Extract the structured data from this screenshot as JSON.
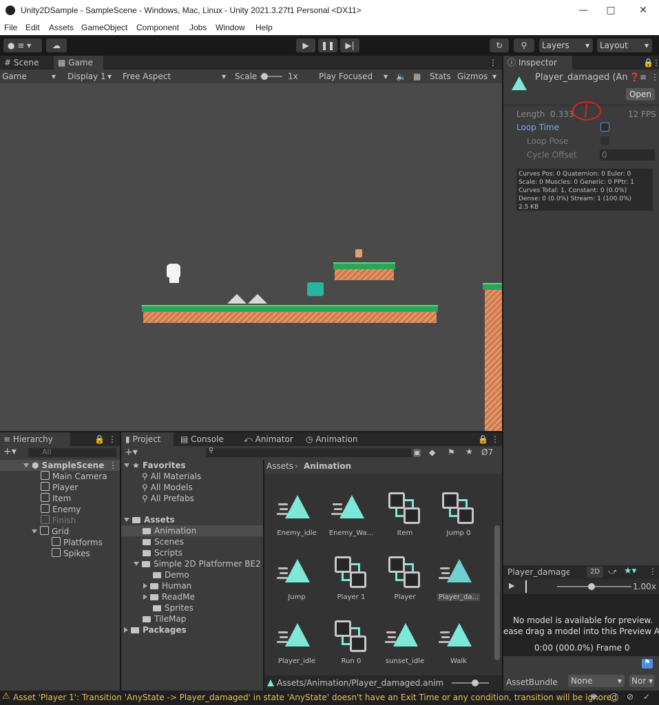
{
  "window": {
    "title": "Unity2DSample - SampleScene - Windows, Mac, Linux - Unity 2021.3.27f1 Personal <DX11>"
  },
  "menu": [
    "File",
    "Edit",
    "Assets",
    "GameObject",
    "Component",
    "Jobs",
    "Window",
    "Help"
  ],
  "toolbar": {
    "layers": "Layers",
    "layout": "Layout"
  },
  "tabs": {
    "scene": "Scene",
    "game": "Game"
  },
  "game_bar": {
    "mode": "Game",
    "display": "Display 1",
    "aspect": "Free Aspect",
    "scale_label": "Scale",
    "scale_value": "1x",
    "play_mode": "Play Focused",
    "stats": "Stats",
    "gizmos": "Gizmos"
  },
  "inspector": {
    "tab": "Inspector",
    "asset_name": "Player_damaged (An",
    "open_button": "Open",
    "length_label": "Length",
    "length_value": "0.333",
    "fps": "12 FPS",
    "loop_time": "Loop Time",
    "loop_pose": "Loop Pose",
    "cycle_offset": "Cycle Offset",
    "cycle_offset_value": "0",
    "info": [
      "Curves Pos: 0 Quaternion: 0 Euler: 0",
      "Scale: 0 Muscles: 0 Generic: 0 PPtr: 1",
      "Curves Total: 1, Constant: 0 (0.0%)",
      "Dense: 0 (0.0%) Stream: 1 (100.0%)",
      "2.5 KB"
    ]
  },
  "preview": {
    "title": "Player_damage",
    "mode_2d": "2D",
    "speed": "1.00x",
    "no_model": "No model is available for preview.",
    "drag_hint": "ease drag a model into this Preview Are",
    "time": "0:00 (000.0%) Frame 0",
    "assetbundle_label": "AssetBundle",
    "assetbundle_value": "None",
    "variant_value": "Nor"
  },
  "hierarchy": {
    "tab": "Hierarchy",
    "search_placeholder": "All",
    "scene": "SampleScene",
    "items": [
      "Main Camera",
      "Player",
      "Item",
      "Enemy",
      "Finish",
      "Grid",
      "Platforms",
      "Spikes"
    ]
  },
  "bottom_tabs": {
    "project": "Project",
    "console": "Console",
    "animator": "Animator",
    "animation": "Animation"
  },
  "project": {
    "favorites": "Favorites",
    "favorites_items": [
      "All Materials",
      "All Models",
      "All Prefabs"
    ],
    "assets": "Assets",
    "folders": [
      "Animation",
      "Scenes",
      "Scripts",
      "Simple 2D Platformer BE2",
      "Demo",
      "Human",
      "ReadMe",
      "Sprites",
      "TileMap"
    ],
    "packages": "Packages",
    "hidden_count": "7",
    "breadcrumb_root": "Assets",
    "breadcrumb_current": "Animation",
    "grid": [
      {
        "label": "Enemy_idle",
        "kind": "clip"
      },
      {
        "label": "Enemy_Wa...",
        "kind": "clip"
      },
      {
        "label": "Item",
        "kind": "controller"
      },
      {
        "label": "Jump 0",
        "kind": "controller"
      },
      {
        "label": "Jump",
        "kind": "clip"
      },
      {
        "label": "Player 1",
        "kind": "controller"
      },
      {
        "label": "Player",
        "kind": "controller"
      },
      {
        "label": "Player_da...",
        "kind": "clip"
      },
      {
        "label": "Player_idle",
        "kind": "clip"
      },
      {
        "label": "Run 0",
        "kind": "controller"
      },
      {
        "label": "sunset_idle",
        "kind": "clip"
      },
      {
        "label": "Walk",
        "kind": "clip"
      }
    ],
    "path": "Assets/Animation/Player_damaged.anim"
  },
  "status": {
    "message": "Asset 'Player 1': Transition 'AnyState -> Player_damaged' in state 'AnyState' doesn't have an Exit Time or any condition, transition will be ignored"
  },
  "colors": {
    "accent": "#7ee8d8",
    "annotation": "#e02020",
    "ground": "#d07c50",
    "grass": "#2aa55a"
  }
}
